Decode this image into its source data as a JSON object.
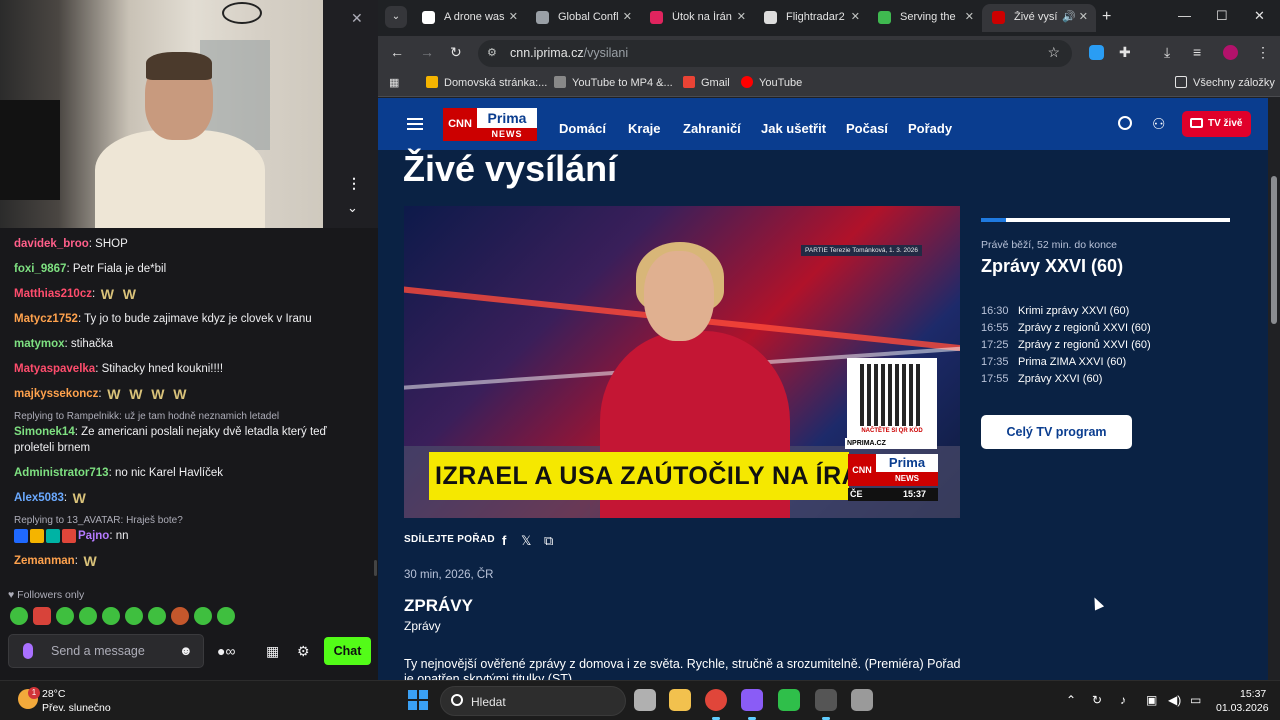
{
  "left_panel": {
    "chat_messages": [
      {
        "user": "davidek_broo",
        "color": "#ff5f8a",
        "text": ": SHOP"
      },
      {
        "user": "foxi_9867",
        "color": "#7ee081",
        "text": ": Petr Fiala je de*bil"
      },
      {
        "user": "Matthias210cz",
        "color": "#ff4d6d",
        "text": ":",
        "emotes": 2
      },
      {
        "user": "Matycz1752",
        "color": "#ffa24d",
        "text": ": Ty jo to bude zajimave kdyz je clovek v Iranu"
      },
      {
        "user": "matymox",
        "color": "#7ee081",
        "text": ": stihačka"
      },
      {
        "user": "Matyaspavelka",
        "color": "#ff4d6d",
        "text": ": Stihacky hned koukni!!!!"
      },
      {
        "user": "majkyssekoncz",
        "color": "#ffa24d",
        "text": ":",
        "emotes": 4
      },
      {
        "reply": "Replying to Rampelnikk: už je tam hodně neznamich letadel",
        "user": "Simonek14",
        "color": "#7ee081",
        "text": ": Ze americani poslali nejaky dvě letadla který teď proleteli brnem"
      },
      {
        "user": "Administrator713",
        "color": "#7ee081",
        "text": ": no nic Karel Havlíček"
      },
      {
        "user": "Alex5083",
        "color": "#6aa9ff",
        "text": ":",
        "emotes": 1
      },
      {
        "reply": "Replying to 13_AVATAR: Hraješ bote?",
        "user": "Pajno",
        "color": "#b57aff",
        "text": ": nn",
        "badges": 4
      },
      {
        "user": "Zemanman",
        "color": "#ffa24d",
        "text": ":",
        "emotes": 1
      }
    ],
    "emote_glyph": "W",
    "followers_only": "Followers only",
    "input_placeholder": "Send a message",
    "chat_button": "Chat",
    "brand_color": "#53fc18"
  },
  "browser": {
    "tabs": [
      {
        "title": "A drone was",
        "fav_color": "#ffffff",
        "active": false
      },
      {
        "title": "Global Confl",
        "fav_color": "#9aa0a6",
        "active": false
      },
      {
        "title": "Útok na Írán",
        "fav_color": "#e0245e",
        "active": false
      },
      {
        "title": "Flightradar2",
        "fav_color": "#dddddd",
        "active": false
      },
      {
        "title": "Serving the",
        "fav_color": "#3fb950",
        "active": false
      },
      {
        "title": "Živé vysí",
        "fav_color": "#cc0000",
        "active": true
      }
    ],
    "url_host": "cnn.iprima.cz",
    "url_path": "/vysilani",
    "bookmarks": [
      {
        "label": "Domovská stránka:...",
        "color": "#f5b400"
      },
      {
        "label": "YouTube to MP4 &...",
        "color": "#888888"
      },
      {
        "label": "Gmail",
        "color": "#ea4335"
      },
      {
        "label": "YouTube",
        "color": "#ff0000"
      }
    ],
    "all_bookmarks": "Všechny záložky"
  },
  "site": {
    "logo": {
      "cnn": "CNN",
      "prima": "Prima",
      "news": "NEWS"
    },
    "nav": [
      "Domácí",
      "Kraje",
      "Zahraničí",
      "Jak ušetřit",
      "Počasí",
      "Pořady"
    ],
    "tv_live": "TV živě",
    "page_title": "Živé vysílání",
    "player": {
      "credit": "PARTIE Terezie Tománková, 1. 3. 2026",
      "qr_caption": "NAČTĚTE SI QR KÓD",
      "qr_site": "NPRIMA.CZ",
      "ticker": "IZRAEL A USA ZAÚTOČILY NA ÍRÁN",
      "clock": "15:37",
      "ce": "ČE"
    },
    "share_label": "SDÍLEJTE POŘAD",
    "meta": "30 min, 2026, ČR",
    "show_title": "ZPRÁVY",
    "show_subtitle": "Zprávy",
    "show_desc": "Ty nejnovější ověřené zprávy z domova i ze světa. Rychle, stručně a srozumitelně. (Premiéra) Pořad je opatřen skrytými titulky (ST)",
    "progress_fraction": 0.1,
    "now_label": "Právě běží, 52 min. do konce",
    "now_title": "Zprávy XXVI (60)",
    "schedule": [
      {
        "time": "16:30",
        "title": "Krimi zprávy XXVI (60)"
      },
      {
        "time": "16:55",
        "title": "Zprávy z regionů XXVI (60)"
      },
      {
        "time": "17:25",
        "title": "Zprávy z regionů XXVI (60)"
      },
      {
        "time": "17:35",
        "title": "Prima ZIMA XXVI (60)"
      },
      {
        "time": "17:55",
        "title": "Zprávy XXVI (60)"
      }
    ],
    "tv_program_button": "Celý TV program"
  },
  "taskbar": {
    "weather_badge": "1",
    "temperature": "28°C",
    "weather_desc": "Přev. slunečno",
    "search_placeholder": "Hledat",
    "apps": [
      {
        "name": "task-view",
        "color": "#b0b0b0",
        "active": false
      },
      {
        "name": "file-explorer",
        "color": "#f2c14e",
        "active": false
      },
      {
        "name": "chrome",
        "color": "#e0463a",
        "active": true
      },
      {
        "name": "screen-recorder",
        "color": "#8a5cf6",
        "active": true
      },
      {
        "name": "xbox",
        "color": "#2fbf4a",
        "active": false
      },
      {
        "name": "obs",
        "color": "#555555",
        "active": true
      },
      {
        "name": "settings",
        "color": "#9a9a9a",
        "active": false
      }
    ],
    "time": "15:37",
    "date": "01.03.2026"
  }
}
